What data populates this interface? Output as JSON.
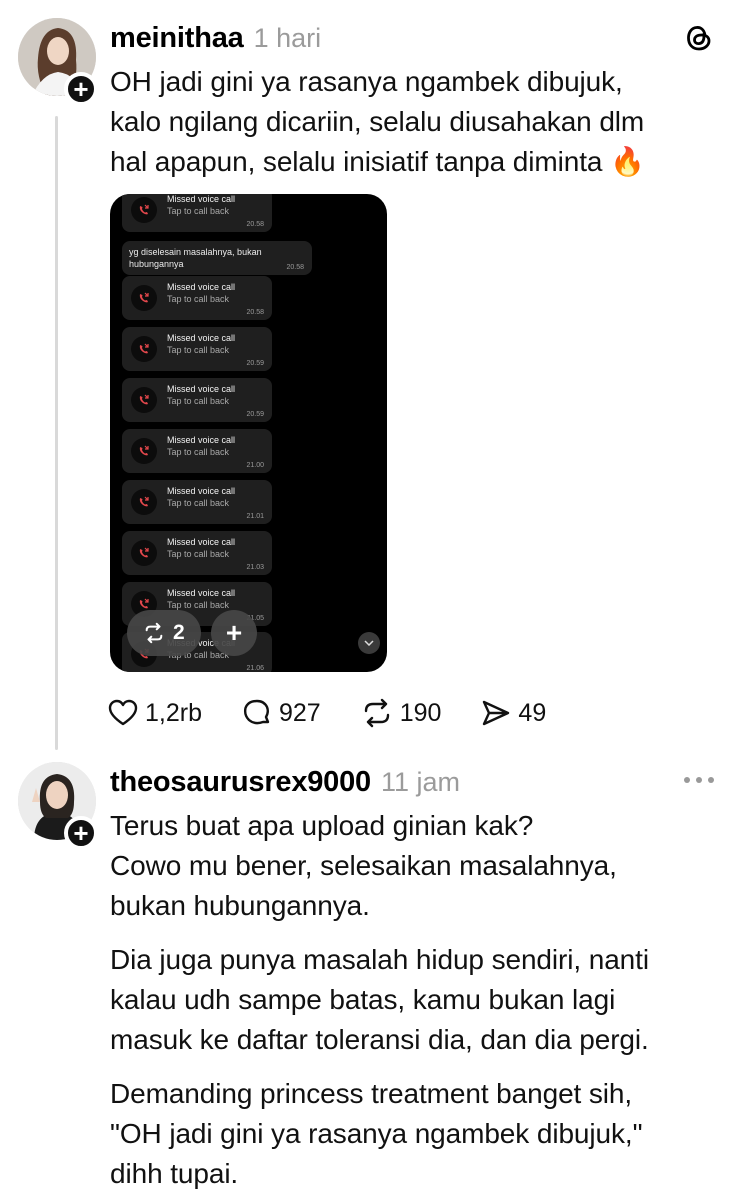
{
  "post1": {
    "username": "meinithaa",
    "timestamp": "1 hari",
    "text_lines": [
      "OH jadi gini ya rasanya ngambek dibujuk,",
      "kalo ngilang dicariin, selalu diusahakan dlm",
      "hal apapun, selalu inisiatif tanpa diminta 🔥"
    ],
    "media": {
      "missed_title": "Missed voice call",
      "missed_sub": "Tap to call back",
      "message_text": "yg diselesain masalahnya, bukan hubungannya",
      "message_time": "20.58",
      "call_times": [
        "20.58",
        "20.58",
        "20.59",
        "20.59",
        "21.00",
        "21.01",
        "21.03",
        "21.05",
        "21.06"
      ],
      "carousel_repost_count": "2",
      "carousel_plus": "+"
    },
    "actions": {
      "likes": "1,2rb",
      "replies": "927",
      "reposts": "190",
      "shares": "49"
    }
  },
  "post2": {
    "username": "theosaurusrex9000",
    "timestamp": "11 jam",
    "paragraphs": [
      [
        "Terus buat apa upload ginian kak?",
        "Cowo mu bener, selesaikan masalahnya,",
        "bukan hubungannya."
      ],
      [
        "Dia juga punya masalah hidup sendiri, nanti",
        "kalau udh sampe batas, kamu bukan lagi",
        "masuk ke daftar toleransi dia, dan dia pergi."
      ],
      [
        "Demanding princess treatment banget sih,",
        "\"OH jadi gini ya rasanya ngambek dibujuk,\"",
        "dihh tupai."
      ]
    ]
  },
  "colors": {
    "background": "#ffffff",
    "text": "#111111",
    "muted": "#9b9b9b",
    "thread_line": "#d9d9d9",
    "missed_call_red": "#e5484d"
  },
  "icons": [
    "threads-logo-icon",
    "plus-icon",
    "heart-icon",
    "comment-icon",
    "repost-icon",
    "share-icon",
    "more-icon",
    "missed-call-icon",
    "chevron-down-icon"
  ]
}
